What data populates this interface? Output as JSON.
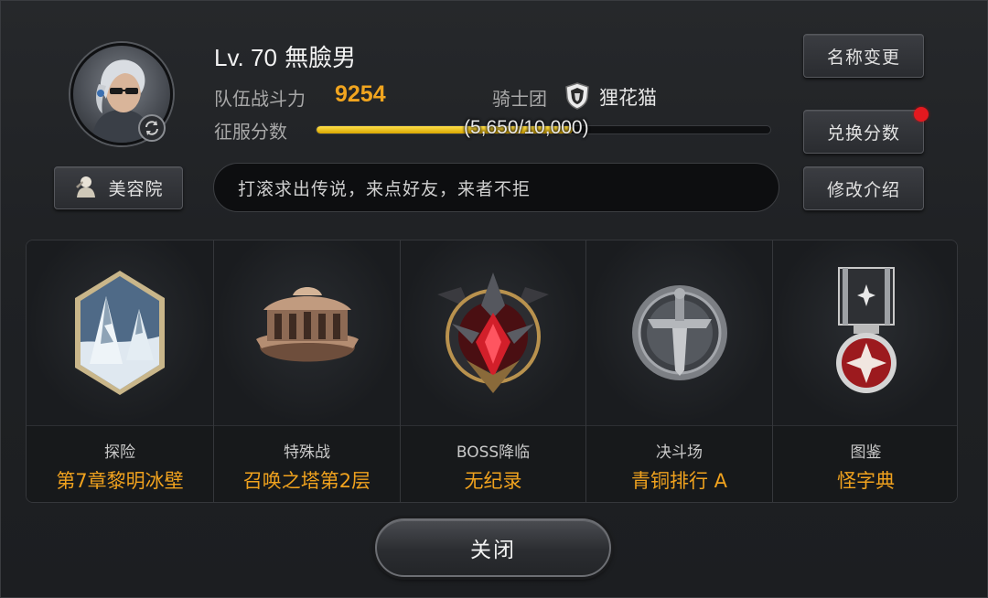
{
  "profile": {
    "level": "Lv. 70",
    "name": "無臉男",
    "power_label": "队伍战斗力",
    "power_value": "9254",
    "guild_label": "骑士团",
    "guild_name": "狸花猫",
    "conquest_label": "征服分数",
    "conquest_text": "(5,650/10,000)",
    "conquest_progress": 0.565,
    "intro": "打滚求出传说，来点好友，来者不拒"
  },
  "buttons": {
    "beauty": "美容院",
    "rename": "名称变更",
    "exchange": "兑换分数",
    "edit_intro": "修改介绍",
    "close": "关闭"
  },
  "cards": [
    {
      "caption": "探险",
      "value": "第7章黎明冰壁",
      "icon": "frozen-mountain-icon"
    },
    {
      "caption": "特殊战",
      "value": "召唤之塔第2层",
      "icon": "tower-icon"
    },
    {
      "caption": "BOSS降临",
      "value": "无纪录",
      "icon": "boss-emblem-icon"
    },
    {
      "caption": "决斗场",
      "value": "青铜排行 A",
      "icon": "bronze-sword-medal-icon"
    },
    {
      "caption": "图鉴",
      "value": "怪字典",
      "icon": "medal-icon"
    }
  ],
  "colors": {
    "accent": "#f1a51f",
    "progress": "#f5c518",
    "notification": "#e3191f"
  }
}
